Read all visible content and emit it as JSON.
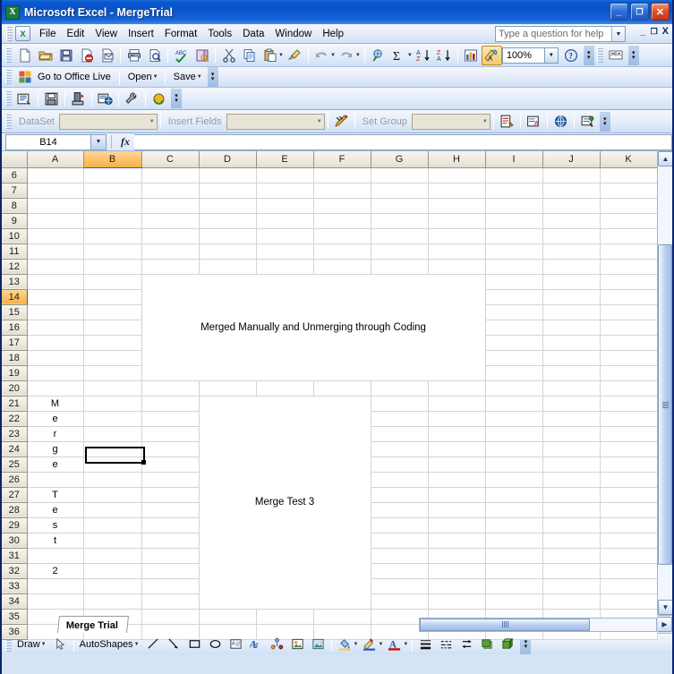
{
  "window": {
    "title": "Microsoft Excel - MergeTrial",
    "app_icon": "excel-icon",
    "minimize": "_",
    "maximize": "❐",
    "close": "✕"
  },
  "menubar": {
    "items": [
      {
        "label": "File",
        "accel": "F"
      },
      {
        "label": "Edit",
        "accel": "E"
      },
      {
        "label": "View",
        "accel": "V"
      },
      {
        "label": "Insert",
        "accel": "I"
      },
      {
        "label": "Format",
        "accel": "o"
      },
      {
        "label": "Tools",
        "accel": "T"
      },
      {
        "label": "Data",
        "accel": "D"
      },
      {
        "label": "Window",
        "accel": "W"
      },
      {
        "label": "Help",
        "accel": "H"
      }
    ],
    "help_placeholder": "Type a question for help",
    "doc_minimize": "_",
    "doc_restore": "❐",
    "doc_close": "X"
  },
  "standard_toolbar": {
    "buttons": [
      "new-icon",
      "open-icon",
      "save-icon",
      "permission-icon",
      "email-icon",
      "print-icon",
      "print-preview-icon",
      "spelling-icon",
      "research-icon",
      "cut-icon",
      "copy-icon",
      "paste-icon",
      "format-painter-icon",
      "undo-icon",
      "redo-icon",
      "insert-hyperlink-icon",
      "autosum-icon",
      "sort-ascending-icon",
      "sort-descending-icon",
      "chart-wizard-icon",
      "drawing-icon",
      "help-icon"
    ],
    "zoom_value": "100%"
  },
  "office_live_toolbar": {
    "logo": "office-live-icon",
    "go_to_label": "Go to Office Live",
    "open_label": "Open",
    "save_label": "Save"
  },
  "dataset_toolbar": {
    "icons_left": [
      "report-icon",
      "save-report-icon",
      "export-icon",
      "publish-icon",
      "settings-icon",
      "refresh-icon"
    ],
    "dataset_label": "DataSet",
    "dataset_value": "",
    "insert_fields_label": "Insert Fields",
    "insert_fields_value": "",
    "set_group_label": "Set Group",
    "set_group_value": "",
    "icons_right": [
      "design-icon",
      "preview-icon",
      "web-icon",
      "properties-icon"
    ]
  },
  "formula_bar": {
    "name_box_value": "B14",
    "fx_label": "fx",
    "formula_value": ""
  },
  "sheet": {
    "columns": [
      "A",
      "B",
      "C",
      "D",
      "E",
      "F",
      "G",
      "H",
      "I",
      "J",
      "K"
    ],
    "selected_column": "B",
    "rows": [
      6,
      7,
      8,
      9,
      10,
      11,
      12,
      13,
      14,
      15,
      16,
      17,
      18,
      19,
      20,
      21,
      22,
      23,
      24,
      25,
      26,
      27,
      28,
      29,
      30,
      31,
      32,
      33,
      34,
      35,
      36
    ],
    "selected_row": 14,
    "active_cell": "B14",
    "column_a_stack": {
      "label": "Merge Test 2 stacked vertically in column A",
      "rows": {
        "21": "M",
        "22": "e",
        "23": "r",
        "24": "g",
        "25": "e",
        "26": "",
        "27": "T",
        "28": "e",
        "29": "s",
        "30": "t",
        "31": "",
        "32": "2"
      }
    },
    "merged_blocks": [
      {
        "name": "merged-block-top",
        "text": "Merged Manually and Unmerging through Coding",
        "range": "C13:H19"
      },
      {
        "name": "merged-block-bottom",
        "text": "Merge Test 3",
        "range": "D21:F34"
      }
    ]
  },
  "tabbar": {
    "nav_first": "|◀",
    "nav_prev": "◀",
    "nav_next": "▶",
    "nav_last": "▶|",
    "sheets": [
      "Merge Trial"
    ],
    "active_sheet": "Merge Trial"
  },
  "drawing_toolbar": {
    "draw_label": "Draw",
    "select_objects_icon": "arrow-select-icon",
    "autoshapes_label": "AutoShapes",
    "tools": [
      "line-icon",
      "arrow-icon",
      "rectangle-icon",
      "oval-icon",
      "text-box-icon",
      "wordart-icon",
      "diagram-icon",
      "clip-art-icon",
      "picture-icon",
      "fill-color-icon",
      "line-color-icon",
      "font-color-icon",
      "line-style-icon",
      "dash-style-icon",
      "arrow-style-icon",
      "shadow-style-icon",
      "3d-style-icon"
    ]
  },
  "colors": {
    "titlebar_blue": "#0a52c8",
    "selected_header_orange": "#fcbf62",
    "grid_line": "#d4d4d4",
    "header_bg": "#eeebe0"
  }
}
